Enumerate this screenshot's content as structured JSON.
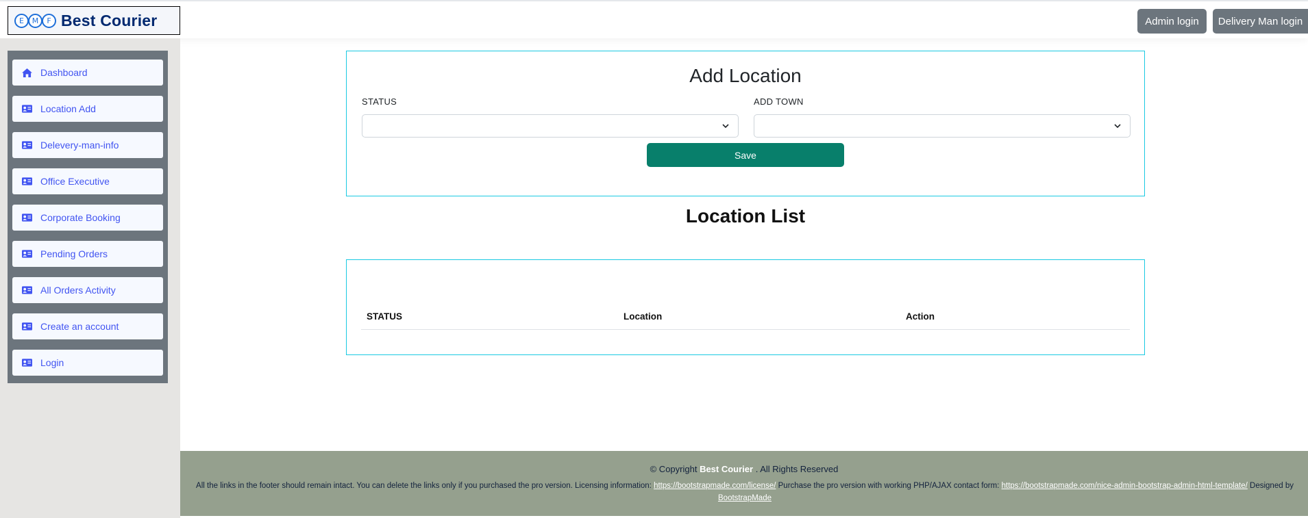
{
  "header": {
    "brand_letters": [
      "E",
      "M",
      "F"
    ],
    "brand_name": "Best Courier",
    "admin_login": "Admin login",
    "delivery_login": "Delivery Man login"
  },
  "sidebar": {
    "items": [
      {
        "label": "Dashboard",
        "icon": "house-icon"
      },
      {
        "label": "Location Add",
        "icon": "id-card-icon"
      },
      {
        "label": "Delevery-man-info",
        "icon": "id-card-icon"
      },
      {
        "label": "Office Executive",
        "icon": "id-card-icon"
      },
      {
        "label": "Corporate Booking",
        "icon": "id-card-icon"
      },
      {
        "label": "Pending Orders",
        "icon": "id-card-icon"
      },
      {
        "label": "All Orders Activity",
        "icon": "id-card-icon"
      },
      {
        "label": "Create an account",
        "icon": "id-card-icon"
      },
      {
        "label": "Login",
        "icon": "id-card-icon"
      }
    ]
  },
  "add_location": {
    "title": "Add Location",
    "status_label": "STATUS",
    "status_value": "",
    "town_label": "ADD TOWN",
    "town_value": "",
    "save_label": "Save"
  },
  "location_list": {
    "title": "Location List",
    "columns": [
      "STATUS",
      "Location",
      "Action"
    ]
  },
  "footer": {
    "copyright_prefix": "© Copyright",
    "copyright_brand": "Best Courier",
    "copyright_suffix": ". All Rights Reserved",
    "credits_text1": "All the links in the footer should remain intact. You can delete the links only if you purchased the pro version. Licensing information:",
    "link1": "https://bootstrapmade.com/license/",
    "credits_text2": "Purchase the pro version with working PHP/AJAX contact form:",
    "link2": "https://bootstrapmade.com/nice-admin-bootstrap-admin-html-template/",
    "credits_text3": "Designed by",
    "link3": "BootstrapMade"
  },
  "colors": {
    "accent": "#4154f1",
    "save_button": "#087f6b",
    "card_border": "#19c9e2",
    "footer_bg": "#95a08e",
    "header_button": "#6c757d"
  }
}
